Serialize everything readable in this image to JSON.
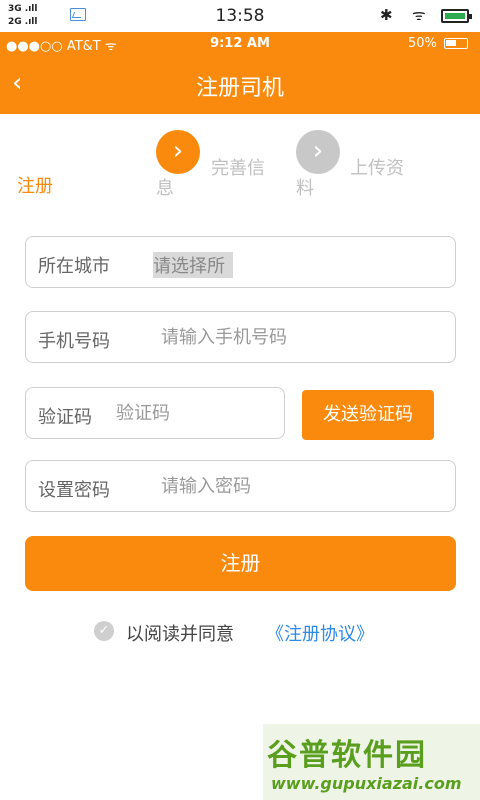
{
  "android_status": {
    "signal_3g": "3G .ıll",
    "signal_2g": "2G .ıll",
    "time": "13:58",
    "bluetooth_icon": "bluetooth-icon",
    "wifi_icon": "wifi-icon",
    "battery_icon": "battery-icon"
  },
  "ios_status": {
    "carrier": "●●●○○ AT&T ᯤ",
    "time": "9:12 AM",
    "battery_pct": "50%"
  },
  "header": {
    "back": "‹",
    "title": "注册司机"
  },
  "steps": {
    "step1": "注册",
    "step2_line1": "完善信",
    "step2_line2": "息",
    "step3_line1": "上传资",
    "step3_line2": "料",
    "arrow": "›"
  },
  "form": {
    "city_label": "所在城市",
    "city_value": "请选择所",
    "phone_label": "手机号码",
    "phone_placeholder": "请输入手机号码",
    "code_label": "验证码",
    "code_placeholder": "验证码",
    "send_code": "发送验证码",
    "password_label": "设置密码",
    "password_placeholder": "请输入密码",
    "submit": "注册"
  },
  "agreement": {
    "check": "✓",
    "text": "以阅读并同意",
    "link": "《注册协议》"
  },
  "watermark": {
    "brand": "谷普软件园",
    "url": "www.gupuxiazai.com"
  },
  "colors": {
    "accent": "#f98a0d",
    "link": "#2e8ae6",
    "step_inactive": "#c8c8c8"
  }
}
